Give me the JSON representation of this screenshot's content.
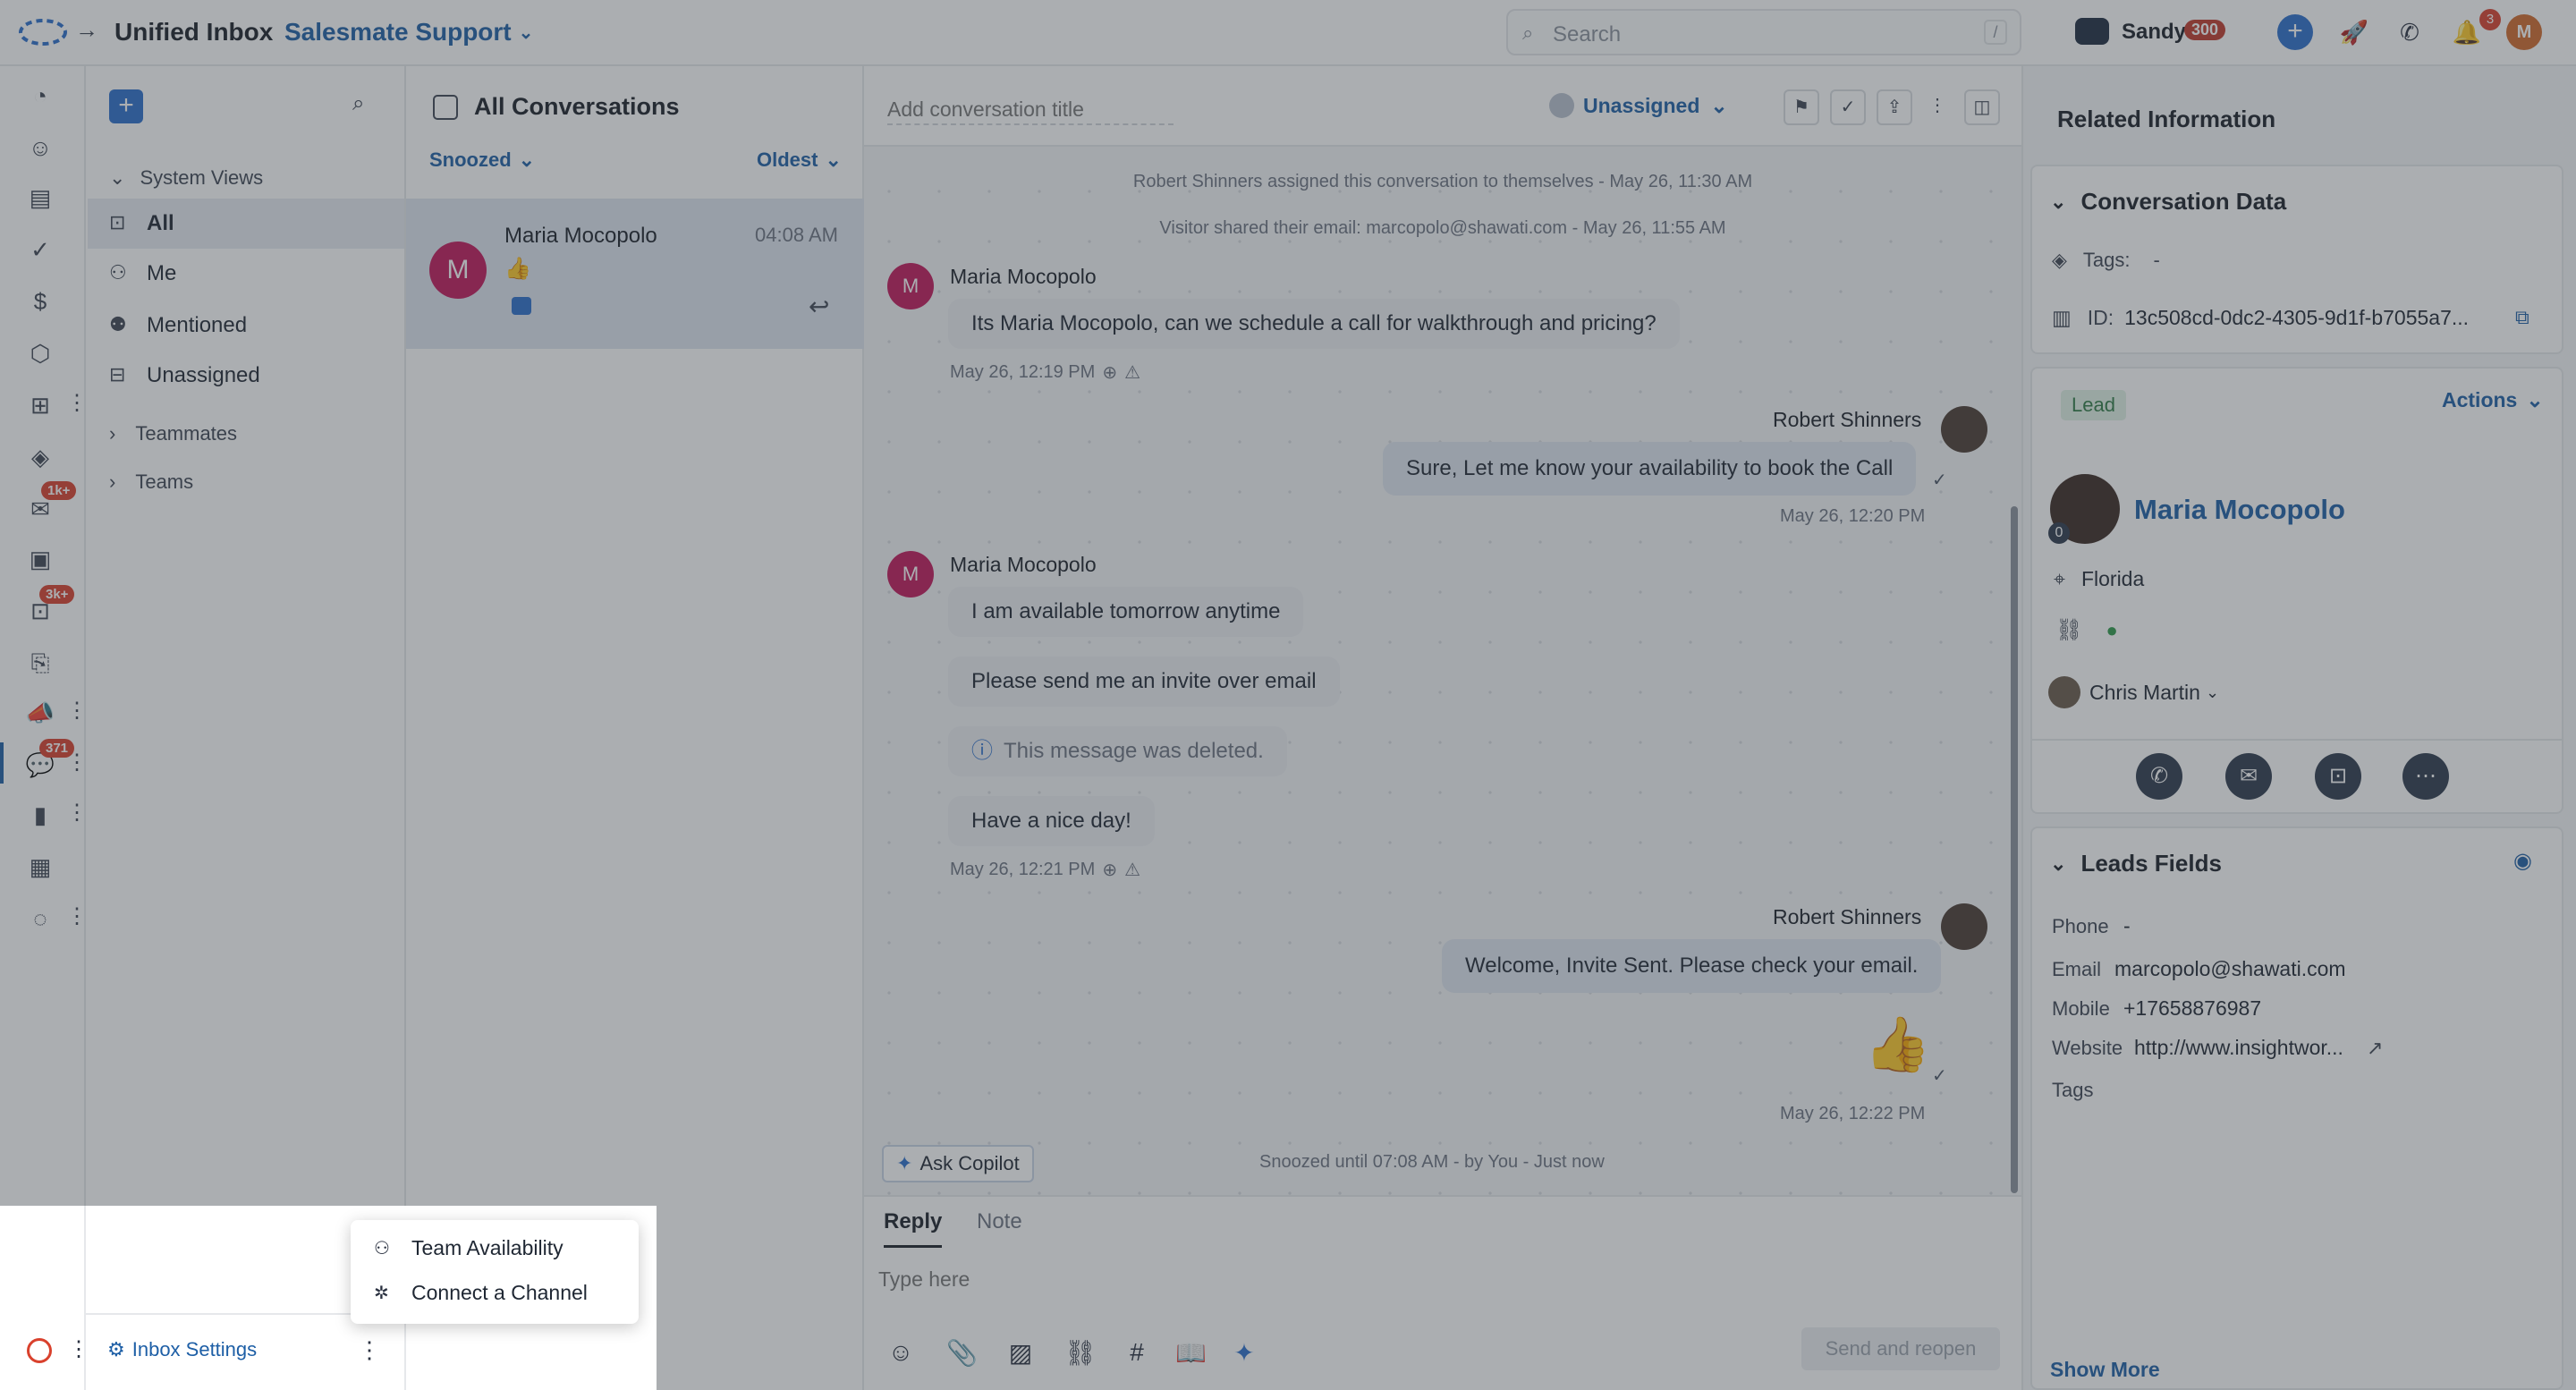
{
  "topbar": {
    "app_title": "Unified Inbox",
    "workspace": "Salesmate Support",
    "search_placeholder": "Search",
    "search_shortcut": "/",
    "user_name": "Sandy",
    "user_badge": "300",
    "notifications_count": "3",
    "avatar_initial": "M"
  },
  "rail": {
    "badges": {
      "email": "1k+",
      "inbox": "3k+",
      "conversations": "371"
    }
  },
  "views": {
    "system_views_label": "System Views",
    "items": [
      {
        "label": "All",
        "icon": "inbox-icon"
      },
      {
        "label": "Me",
        "icon": "person-icon"
      },
      {
        "label": "Mentioned",
        "icon": "mention-icon"
      },
      {
        "label": "Unassigned",
        "icon": "unassigned-icon"
      }
    ],
    "groups": [
      "Teammates",
      "Teams"
    ],
    "inbox_settings": "Inbox Settings"
  },
  "convlist": {
    "title": "All Conversations",
    "filter": "Snoozed",
    "sort": "Oldest",
    "conversations": [
      {
        "name": "Maria Mocopolo",
        "initial": "M",
        "time": "04:08 AM",
        "preview": "👍"
      }
    ]
  },
  "chat": {
    "title_placeholder": "Add conversation title",
    "assignee": "Unassigned",
    "system_messages": [
      "Robert Shinners assigned this conversation to themselves - May 26, 11:30 AM",
      "Visitor shared their email: marcopolo@shawati.com - May 26, 11:55 AM"
    ],
    "messages": [
      {
        "sender": "Maria Mocopolo",
        "initial": "M",
        "text": "Its Maria Mocopolo, can we schedule a call for walkthrough and pricing?",
        "time": "May 26, 12:19 PM"
      },
      {
        "sender": "Robert Shinners",
        "text": "Sure, Let me know your availability to book the Call",
        "time": "May 26, 12:20 PM"
      },
      {
        "sender": "Maria Mocopolo",
        "initial": "M",
        "texts": [
          "I am available tomorrow anytime",
          "Please send me an invite over email",
          "This message was deleted.",
          "Have a nice day!"
        ],
        "time": "May 26, 12:21 PM"
      },
      {
        "sender": "Robert Shinners",
        "text": "Welcome, Invite Sent. Please check your email.",
        "emoji": "👍",
        "time": "May 26, 12:22 PM"
      }
    ],
    "ask_copilot": "Ask Copilot",
    "snooze_status": "Snoozed until 07:08 AM - by You - Just now"
  },
  "reply": {
    "tabs": [
      "Reply",
      "Note"
    ],
    "placeholder": "Type here",
    "send_label": "Send and reopen"
  },
  "related": {
    "title": "Related Information",
    "conversation_data": {
      "title": "Conversation Data",
      "tags_label": "Tags:",
      "tags_value": "-",
      "id_label": "ID:",
      "id_value": "13c508cd-0dc2-4305-9d1f-b7055a7..."
    },
    "contact": {
      "tag": "Lead",
      "actions": "Actions",
      "name": "Maria Mocopolo",
      "badge": "0",
      "location": "Florida",
      "owner": "Chris Martin"
    },
    "leads_fields": {
      "title": "Leads Fields",
      "fields": [
        {
          "label": "Phone",
          "value": "-"
        },
        {
          "label": "Email",
          "value": "marcopolo@shawati.com"
        },
        {
          "label": "Mobile",
          "value": "+17658876987"
        },
        {
          "label": "Website",
          "value": "http://www.insightwor..."
        },
        {
          "label": "Tags",
          "value": ""
        }
      ],
      "show_more": "Show More"
    }
  },
  "popup_menu": {
    "items": [
      "Team Availability",
      "Connect a Channel"
    ]
  },
  "colors": {
    "accent": "#1e5fa6",
    "badge_red": "#d9412d",
    "lead_green": "#2f7a45"
  }
}
